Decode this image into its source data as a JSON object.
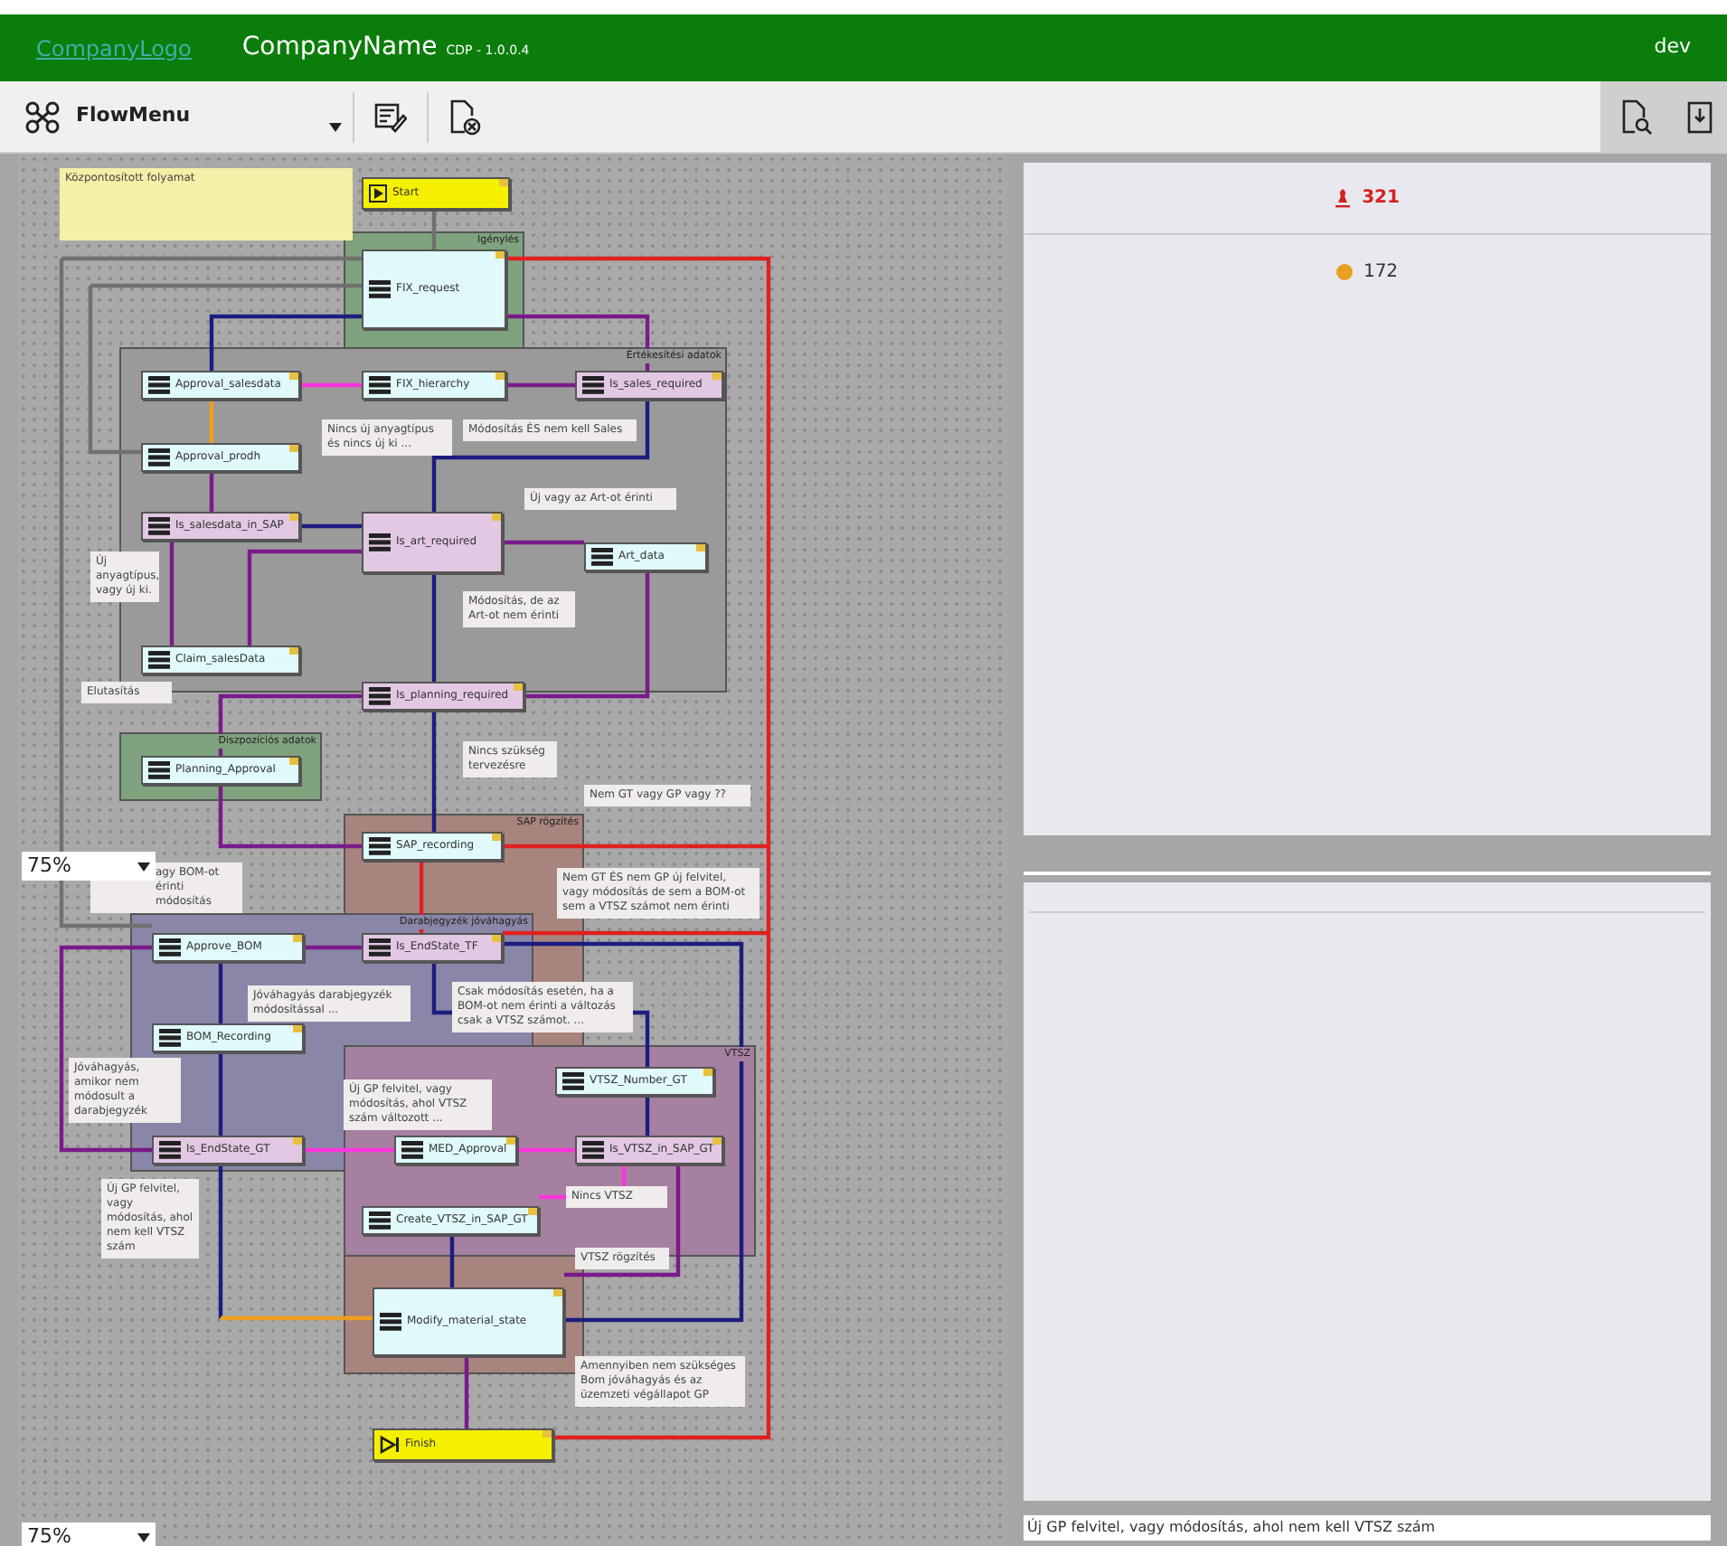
{
  "header": {
    "logo": "CompanyLogo",
    "company": "CompanyName",
    "version": "CDP - 1.0.0.4",
    "user": "dev"
  },
  "toolbar": {
    "menu": "FlowMenu"
  },
  "diagram": {
    "groups": [
      {
        "label": "Igénylés",
        "color": "#7fa27f"
      },
      {
        "label": "Értékesítési adatok",
        "color": "#9a9a9a"
      },
      {
        "label": "Diszpozíciós adatok",
        "color": "#7fa27f"
      },
      {
        "label": "SAP rögzítés",
        "color": "#a8847e"
      },
      {
        "label": "Darabjegyzék jóváhagyás",
        "color": "#8a86a8"
      },
      {
        "label": "VTSZ",
        "color": "#a680a0"
      }
    ],
    "nodes": [
      {
        "label": "Start",
        "kind": "start"
      },
      {
        "label": "FIX_request",
        "kind": "task"
      },
      {
        "label": "Approval_salesdata",
        "kind": "task"
      },
      {
        "label": "FIX_hierarchy",
        "kind": "task"
      },
      {
        "label": "Is_sales_required",
        "kind": "decision"
      },
      {
        "label": "Approval_prodh",
        "kind": "task"
      },
      {
        "label": "Is_salesdata_in_SAP",
        "kind": "decision"
      },
      {
        "label": "Is_art_required",
        "kind": "decision"
      },
      {
        "label": "Art_data",
        "kind": "task"
      },
      {
        "label": "Claim_salesData",
        "kind": "task"
      },
      {
        "label": "Is_planning_required",
        "kind": "decision"
      },
      {
        "label": "Planning_Approval",
        "kind": "task"
      },
      {
        "label": "SAP_recording",
        "kind": "task"
      },
      {
        "label": "Approve_BOM",
        "kind": "task"
      },
      {
        "label": "Is_EndState_TF",
        "kind": "decision"
      },
      {
        "label": "BOM_Recording",
        "kind": "task"
      },
      {
        "label": "VTSZ_Number_GT",
        "kind": "task"
      },
      {
        "label": "Is_EndState_GT",
        "kind": "decision"
      },
      {
        "label": "MED_Approval",
        "kind": "task"
      },
      {
        "label": "Is_VTSZ_in_SAP_GT",
        "kind": "decision"
      },
      {
        "label": "Create_VTSZ_in_SAP_GT",
        "kind": "task"
      },
      {
        "label": "Modify_material_state",
        "kind": "task"
      },
      {
        "label": "Finish",
        "kind": "finish"
      }
    ],
    "notes": [
      {
        "text": "Központosított folyamat",
        "kind": "sticky"
      },
      {
        "text": "Nincs új anyagtípus és nincs új ki ...",
        "kind": "comment"
      },
      {
        "text": "Módosítás ÉS nem kell Sales",
        "kind": "comment"
      },
      {
        "text": "Új vagy az Art-ot érinti",
        "kind": "comment"
      },
      {
        "text": "Új anyagtípus, vagy új ki.",
        "kind": "comment"
      },
      {
        "text": "Módosítás, de az Art-ot nem érinti",
        "kind": "comment"
      },
      {
        "text": "Elutasítás",
        "kind": "comment"
      },
      {
        "text": "Nincs szükség tervezésre",
        "kind": "comment"
      },
      {
        "text": "Nem GT vagy GP vagy ??",
        "kind": "comment"
      },
      {
        "text": "agy BOM-ot érinti módosítás",
        "kind": "comment"
      },
      {
        "text": "Nem GT ÉS nem GP új felvitel, vagy módosítás de sem a BOM-ot sem a VTSZ számot nem érinti",
        "kind": "comment"
      },
      {
        "text": "Jóváhagyás darabjegyzék módosítással ...",
        "kind": "comment"
      },
      {
        "text": "Csak módosítás esetén, ha a BOM-ot nem érinti a változás csak a VTSZ számot. ...",
        "kind": "comment"
      },
      {
        "text": "Jóváhagyás, amikor nem módosult a darabjegyzék",
        "kind": "comment"
      },
      {
        "text": "Új GP felvitel, vagy módosítás, ahol VTSZ szám változott ...",
        "kind": "comment"
      },
      {
        "text": "Új GP felvitel, vagy módosítás, ahol nem kell VTSZ szám",
        "kind": "comment"
      },
      {
        "text": "Nincs VTSZ",
        "kind": "comment"
      },
      {
        "text": "VTSZ rögzítés",
        "kind": "comment"
      },
      {
        "text": "Amennyiben nem szükséges Bom jóváhagyás és az üzemzeti végállapot GP",
        "kind": "comment"
      }
    ],
    "zoom_controls": [
      "75%",
      "75%"
    ]
  },
  "stats": [
    {
      "value": "321",
      "kind": "alert"
    },
    {
      "value": "172",
      "kind": "dot",
      "color": "#e8a020"
    }
  ],
  "footer": "Új GP felvitel, vagy módosítás, ahol nem kell VTSZ szám"
}
